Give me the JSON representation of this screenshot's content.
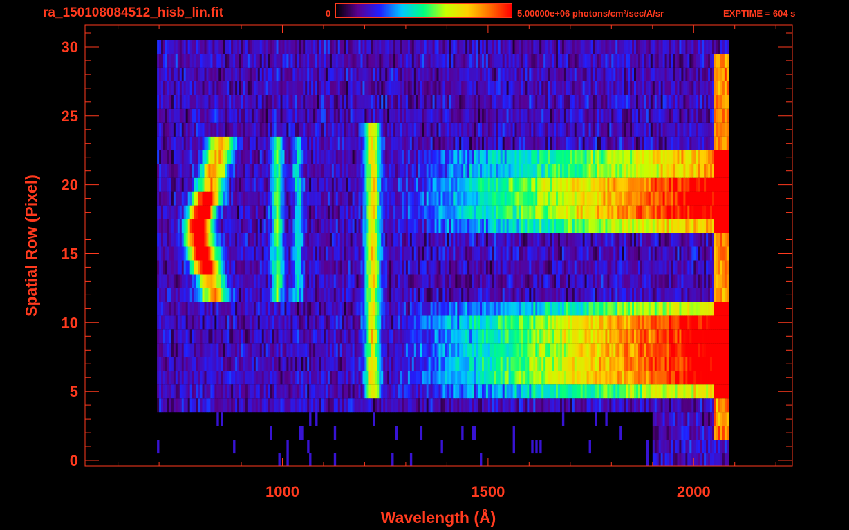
{
  "header": {
    "file_title": "ra_150108084512_hisb_lin.fit",
    "colorbar_min": "0",
    "colorbar_max": "5.00000e+06 photons/cm²/sec/A/sr",
    "exptime": "EXPTIME = 604 s"
  },
  "colors": {
    "axis": "#ff3a1e",
    "background": "#000000",
    "colormap": [
      "#000000",
      "#5a0090",
      "#2020ff",
      "#00c8ff",
      "#00ff80",
      "#c8ff00",
      "#ffd000",
      "#ff7000",
      "#ff0000"
    ]
  },
  "chart_data": {
    "type": "heatmap",
    "xlabel": "Wavelength (Å)",
    "ylabel": "Spatial Row (Pixel)",
    "xlim": [
      520,
      2240
    ],
    "ylim": [
      -0.4,
      31.6
    ],
    "xticks": [
      1000,
      1500,
      2000
    ],
    "xtick_labels": [
      "1000",
      "1500",
      "2000"
    ],
    "yticks": [
      0,
      5,
      10,
      15,
      20,
      25,
      30
    ],
    "ytick_labels": [
      "0",
      "5",
      "10",
      "15",
      "20",
      "25",
      "30"
    ],
    "colorbar_range": [
      0,
      5000000
    ],
    "data_extent": {
      "wavelength": [
        695,
        2065
      ],
      "rows": [
        0,
        30
      ]
    },
    "features": [
      {
        "name": "broad emission arc",
        "wavelength": [
          780,
          940
        ],
        "rows": [
          12,
          23
        ],
        "peak_rows": [
          14,
          19
        ],
        "level": 1.0
      },
      {
        "name": "narrow line",
        "wavelength": [
          1205,
          1230
        ],
        "rows": [
          5,
          24
        ],
        "level": 0.55
      },
      {
        "name": "upper continuum band",
        "wavelength": [
          1250,
          2065
        ],
        "rows": [
          17,
          22
        ],
        "level": 0.9
      },
      {
        "name": "lower continuum band",
        "wavelength": [
          1250,
          2065
        ],
        "rows": [
          5,
          11
        ],
        "level": 0.9
      },
      {
        "name": "edge line",
        "wavelength": [
          2050,
          2065
        ],
        "rows": [
          2,
          29
        ],
        "level": 0.95
      }
    ]
  }
}
